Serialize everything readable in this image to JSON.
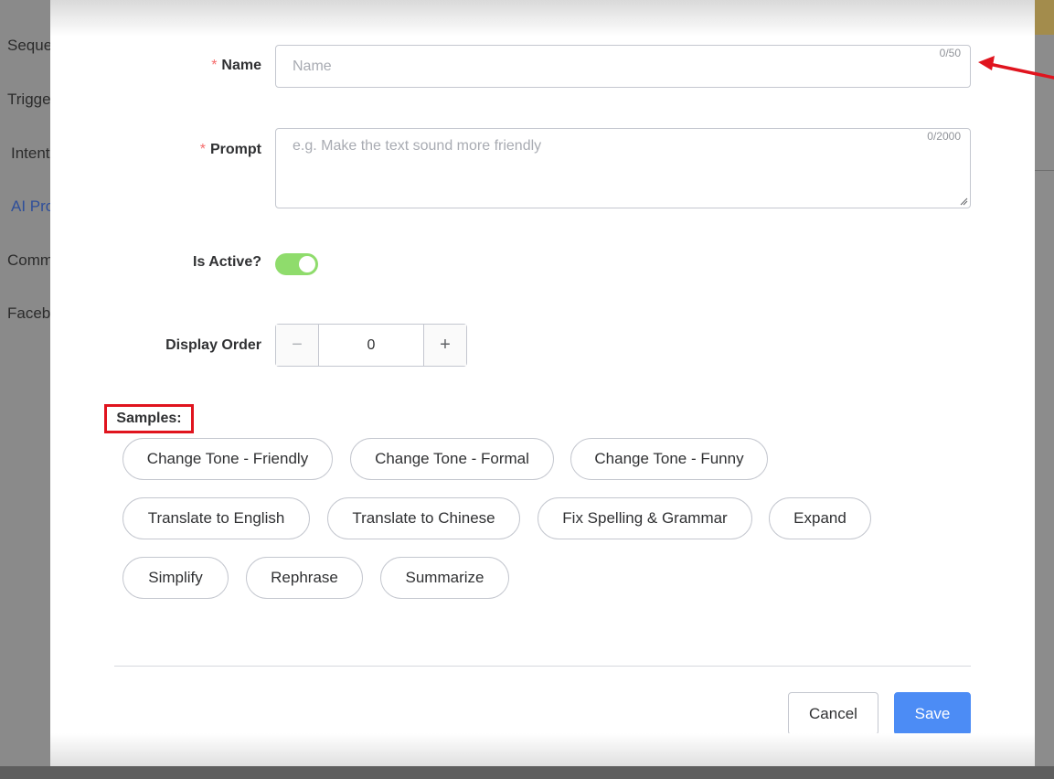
{
  "background_sidebar": {
    "items": [
      "Seque",
      "Trigge",
      "Intent",
      "AI Pro",
      "Comm",
      "Facebo"
    ],
    "active_item": "AI Pro"
  },
  "form": {
    "name": {
      "label": "Name",
      "required_marker": "*",
      "placeholder": "Name",
      "value": "",
      "counter": "0/50"
    },
    "prompt": {
      "label": "Prompt",
      "required_marker": "*",
      "placeholder": "e.g. Make the text sound more friendly",
      "value": "",
      "counter": "0/2000"
    },
    "is_active": {
      "label": "Is Active?",
      "on": true
    },
    "display_order": {
      "label": "Display Order",
      "value": "0",
      "decrement": "−",
      "increment": "+"
    }
  },
  "samples": {
    "label": "Samples:",
    "chips": [
      "Change Tone - Friendly",
      "Change Tone - Formal",
      "Change Tone - Funny",
      "Translate to English",
      "Translate to Chinese",
      "Fix Spelling & Grammar",
      "Expand",
      "Simplify",
      "Rephrase",
      "Summarize"
    ]
  },
  "footer": {
    "cancel_label": "Cancel",
    "save_label": "Save"
  },
  "colors": {
    "required": "#f56c6c",
    "toggle_on": "#8fdc6c",
    "primary": "#4c8cf5",
    "highlight_box": "#e0141e",
    "annotation_arrow": "#e0141e"
  }
}
